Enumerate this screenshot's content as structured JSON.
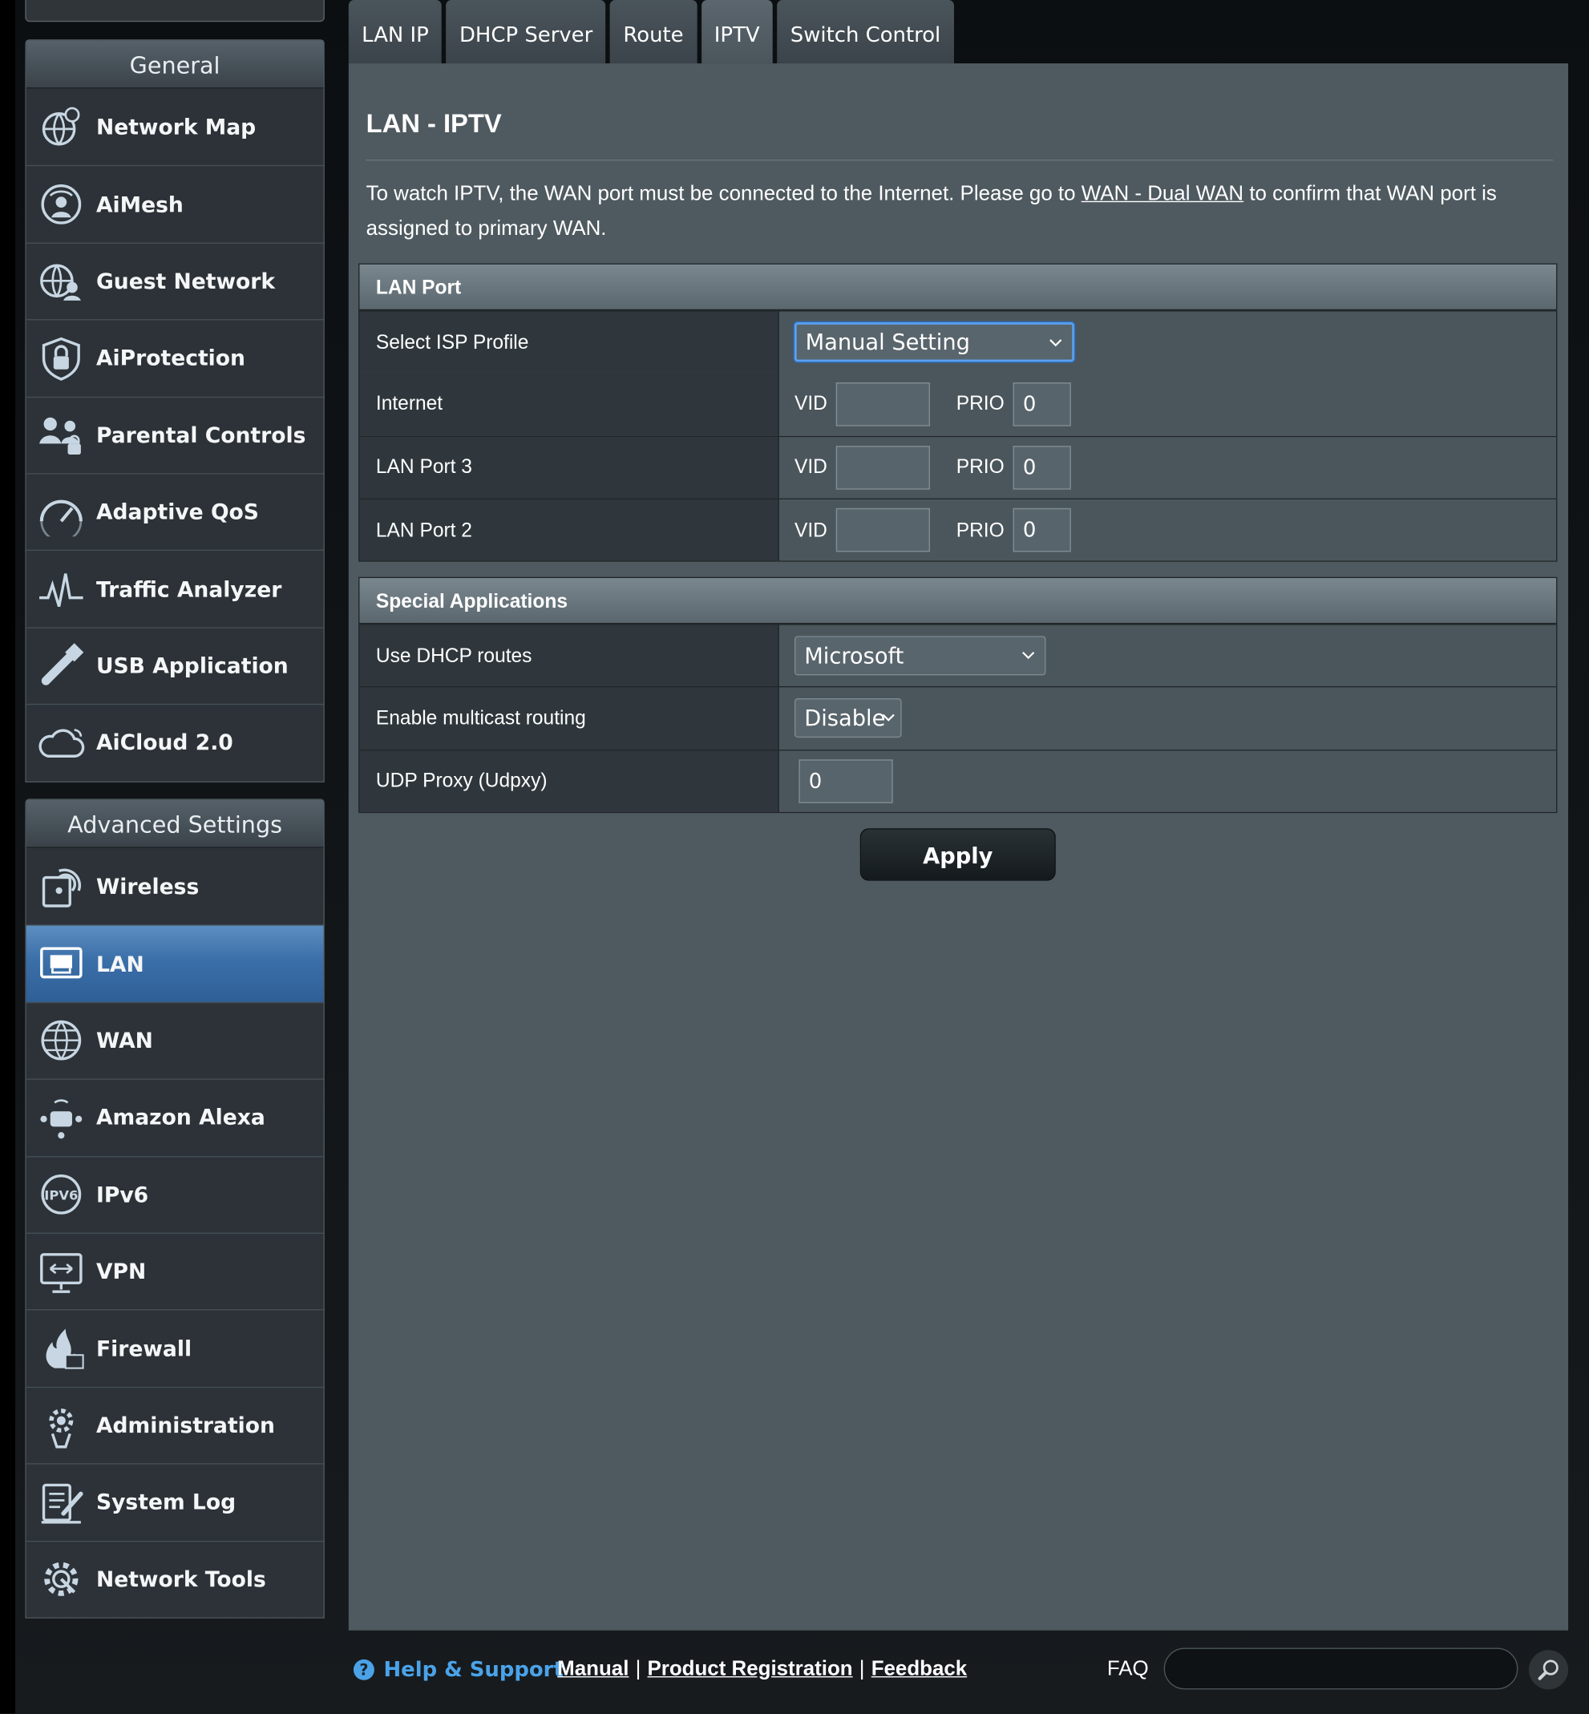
{
  "sidebar": {
    "general": {
      "header": "General",
      "items": [
        {
          "label": "Network Map",
          "icon": "network-map-icon"
        },
        {
          "label": "AiMesh",
          "icon": "aimesh-icon"
        },
        {
          "label": "Guest Network",
          "icon": "guest-network-icon"
        },
        {
          "label": "AiProtection",
          "icon": "aiprotection-icon"
        },
        {
          "label": "Parental Controls",
          "icon": "parental-controls-icon"
        },
        {
          "label": "Adaptive QoS",
          "icon": "adaptive-qos-icon"
        },
        {
          "label": "Traffic Analyzer",
          "icon": "traffic-analyzer-icon"
        },
        {
          "label": "USB Application",
          "icon": "usb-application-icon"
        },
        {
          "label": "AiCloud 2.0",
          "icon": "aicloud-icon"
        }
      ]
    },
    "advanced": {
      "header": "Advanced Settings",
      "items": [
        {
          "label": "Wireless",
          "icon": "wireless-icon"
        },
        {
          "label": "LAN",
          "icon": "lan-icon",
          "active": true
        },
        {
          "label": "WAN",
          "icon": "wan-icon"
        },
        {
          "label": "Amazon Alexa",
          "icon": "amazon-alexa-icon"
        },
        {
          "label": "IPv6",
          "icon": "ipv6-icon"
        },
        {
          "label": "VPN",
          "icon": "vpn-icon"
        },
        {
          "label": "Firewall",
          "icon": "firewall-icon"
        },
        {
          "label": "Administration",
          "icon": "administration-icon"
        },
        {
          "label": "System Log",
          "icon": "system-log-icon"
        },
        {
          "label": "Network Tools",
          "icon": "network-tools-icon"
        }
      ]
    }
  },
  "tabs": [
    "LAN IP",
    "DHCP Server",
    "Route",
    "IPTV",
    "Switch Control"
  ],
  "active_tab": "IPTV",
  "page": {
    "title": "LAN - IPTV",
    "desc_before": "To watch IPTV, the WAN port must be connected to the Internet. Please go to ",
    "desc_link": "WAN - Dual WAN",
    "desc_after": " to confirm that WAN port is assigned to primary WAN."
  },
  "lan_port": {
    "header": "LAN Port",
    "isp_profile_label": "Select ISP Profile",
    "isp_profile_value": "Manual Setting",
    "vid_label": "VID",
    "prio_label": "PRIO",
    "rows": [
      {
        "label": "Internet",
        "vid": "",
        "prio": "0"
      },
      {
        "label": "LAN Port 3",
        "vid": "",
        "prio": "0"
      },
      {
        "label": "LAN Port 2",
        "vid": "",
        "prio": "0"
      }
    ]
  },
  "special": {
    "header": "Special Applications",
    "dhcp_routes_label": "Use DHCP routes",
    "dhcp_routes_value": "Microsoft",
    "multicast_label": "Enable multicast routing",
    "multicast_value": "Disable",
    "udpxy_label": "UDP Proxy (Udpxy)",
    "udpxy_value": "0"
  },
  "apply_label": "Apply",
  "footer": {
    "help_label": "Help & Support",
    "manual": "Manual",
    "product_registration": "Product Registration",
    "feedback": "Feedback",
    "sep": "|",
    "faq": "FAQ"
  },
  "colors": {
    "accent_blue": "#4aa3e9",
    "active_nav": "#3b6fa8",
    "content_bg": "#4f5a60"
  }
}
